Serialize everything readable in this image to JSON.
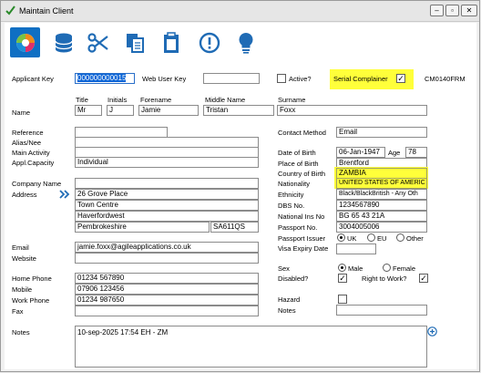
{
  "window": {
    "title": "Maintain Client",
    "form_code": "CM0140FRM"
  },
  "toolbar": {
    "items": [
      "logo-icon",
      "database-icon",
      "scissors-icon",
      "copy-icon",
      "clipboard-icon",
      "alert-icon",
      "lightbulb-icon"
    ]
  },
  "labels": {
    "applicant_key": "Applicant Key",
    "web_user_key": "Web User Key",
    "active": "Active?",
    "serial_complainer": "Serial Complainer",
    "name": "Name",
    "title": "Title",
    "initials": "Initials",
    "forename": "Forename",
    "middle_name": "Middle Name",
    "surname": "Surname",
    "reference": "Reference",
    "alias": "Alias/Nee",
    "main_activity": "Main Activity",
    "appl_capacity": "Appl.Capacity",
    "contact_method": "Contact Method",
    "date_of_birth": "Date of Birth",
    "age": "Age",
    "place_of_birth": "Place of Birth",
    "country_of_birth": "Country of Birth",
    "nationality": "Nationality",
    "ethnicity": "Ethnicity",
    "dbs_no": "DBS No.",
    "national_ins_no": "National Ins No",
    "passport_no": "Passport No.",
    "passport_issuer": "Passport Issuer",
    "visa_expiry": "Visa Expiry Date",
    "company_name": "Company Name",
    "address": "Address",
    "email": "Email",
    "website": "Website",
    "home_phone": "Home Phone",
    "mobile": "Mobile",
    "work_phone": "Work Phone",
    "fax": "Fax",
    "sex": "Sex",
    "disabled": "Disabled?",
    "right_to_work": "Right to Work?",
    "hazard": "Hazard",
    "notes_right": "Notes",
    "notes": "Notes",
    "uk": "UK",
    "eu": "EU",
    "other": "Other",
    "male": "Male",
    "female": "Female"
  },
  "values": {
    "applicant_key": "000000000015",
    "web_user_key": "",
    "title": "Mr",
    "initials": "J",
    "forename": "Jamie",
    "middle_name": "Tristan",
    "surname": "Foxx",
    "appl_capacity": "Individual",
    "contact_method": "Email",
    "date_of_birth": "06-Jan-1947",
    "age": "78",
    "place_of_birth": "Brentford",
    "country_of_birth": "ZAMBIA",
    "nationality": "UNITED STATES OF AMERIC",
    "ethnicity": "Black/BlackBritish - Any Oth",
    "dbs_no": "1234567890",
    "national_ins_no": "BG 65 43 21A",
    "passport_no": "3004005006",
    "address": [
      "26 Grove Place",
      "Town Centre",
      "Haverfordwest",
      "Pembrokeshire"
    ],
    "postcode": "SA611QS",
    "email": "jamie.foxx@agileapplications.co.uk",
    "home_phone": "01234 567890",
    "mobile": "07906 123456",
    "work_phone": "01234 987650",
    "notes": "10-sep-2025 17:54 EH - ZM"
  },
  "state": {
    "active": false,
    "serial_complainer": true,
    "passport_issuer": "UK",
    "sex": "Male",
    "disabled": true,
    "right_to_work": true,
    "hazard": false
  },
  "colors": {
    "highlight": "#ffff3a",
    "accent": "#0f6fc3",
    "selection": "#0a64d6"
  }
}
